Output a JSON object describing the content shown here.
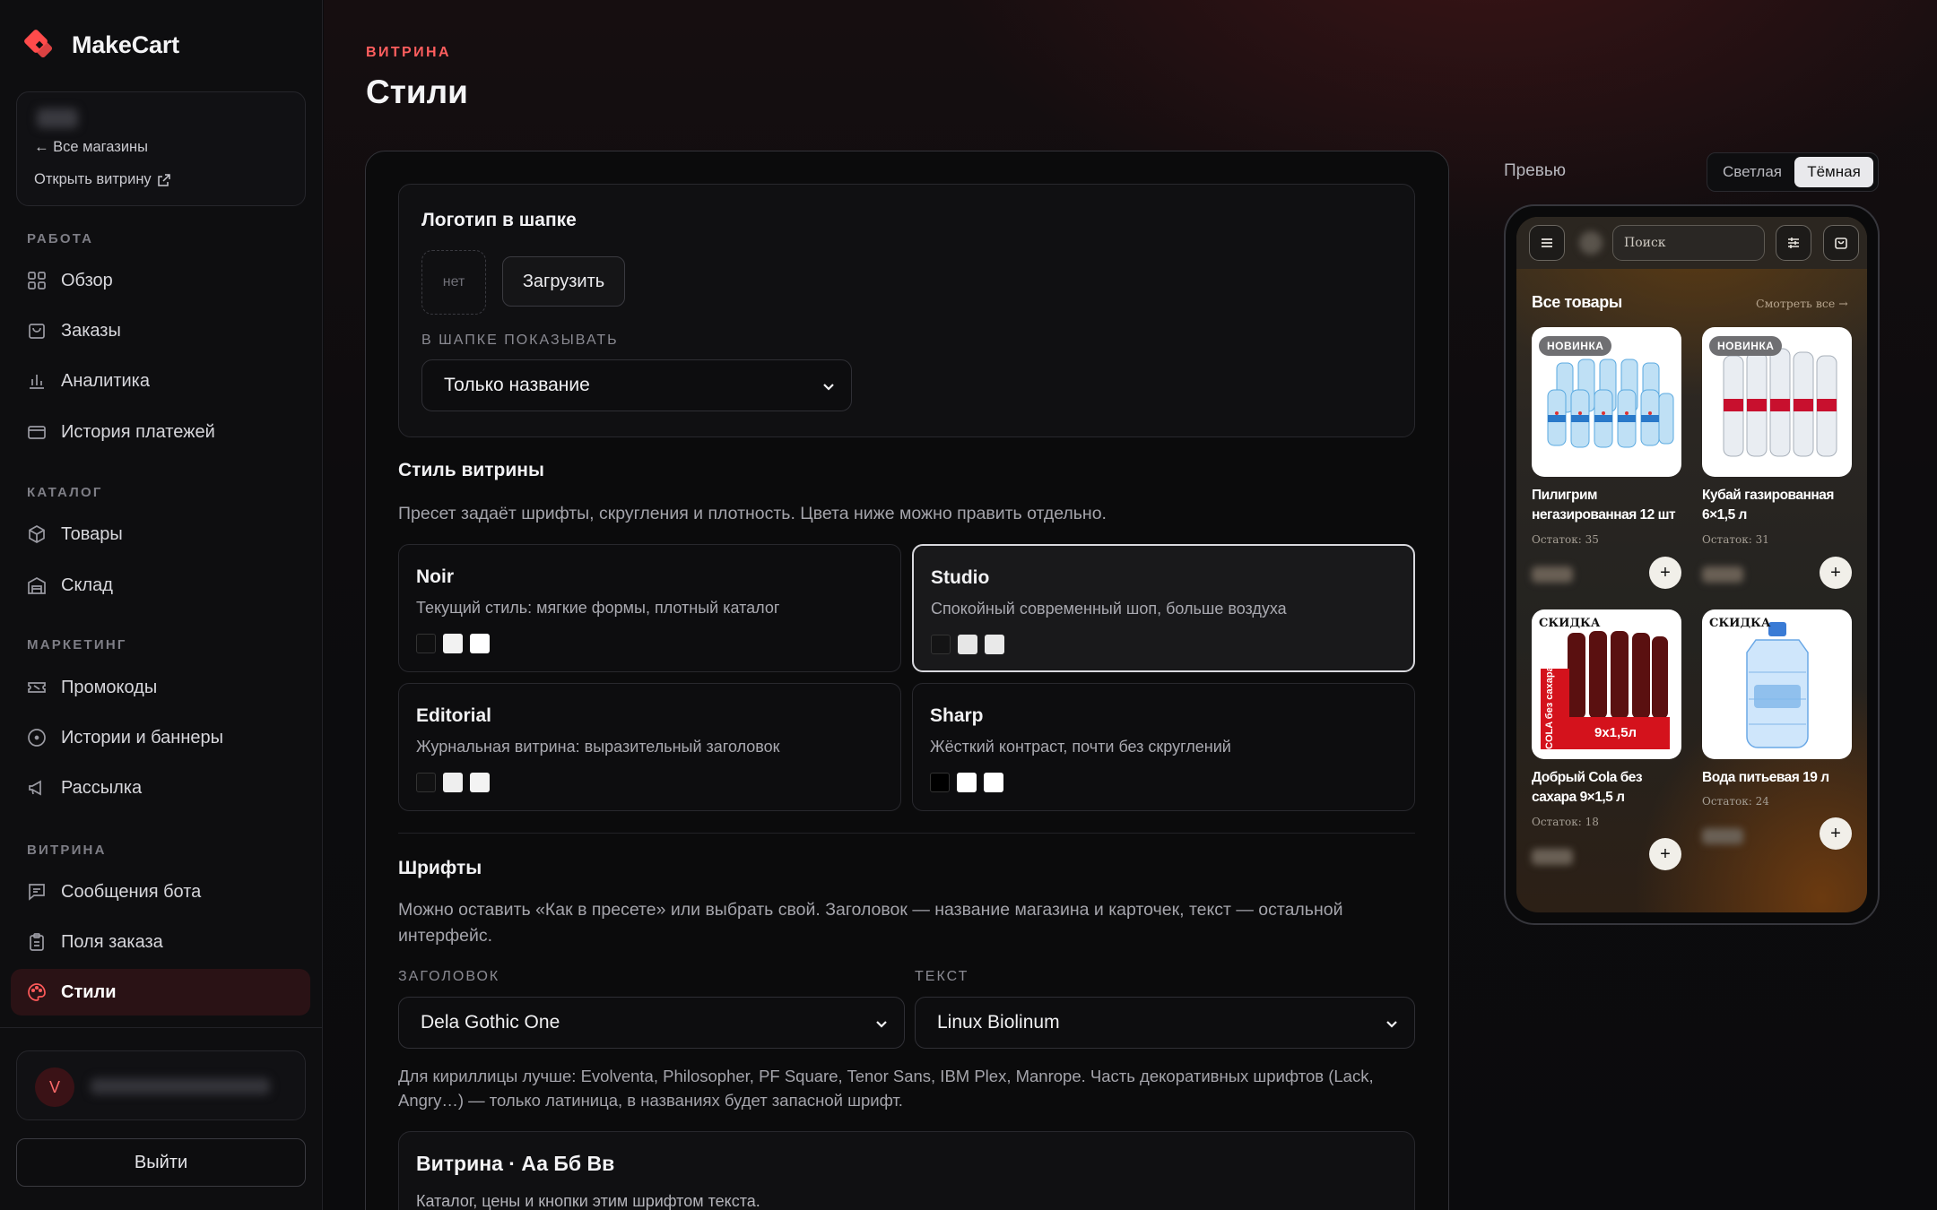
{
  "app": {
    "name": "MakeCart",
    "accent": "#ff4b4b"
  },
  "store_box": {
    "back_label": "← Все магазины",
    "open_label": "Открыть витрину"
  },
  "sidebar": {
    "work_label": "РАБОТА",
    "work_items": [
      {
        "label": "Обзор",
        "icon": "grid-icon"
      },
      {
        "label": "Заказы",
        "icon": "bag-icon"
      },
      {
        "label": "Аналитика",
        "icon": "bar-chart-icon"
      },
      {
        "label": "История платежей",
        "icon": "card-icon"
      }
    ],
    "catalog_label": "КАТАЛОГ",
    "catalog_items": [
      {
        "label": "Товары",
        "icon": "box-icon"
      },
      {
        "label": "Склад",
        "icon": "warehouse-icon"
      }
    ],
    "marketing_label": "МАРКЕТИНГ",
    "marketing_items": [
      {
        "label": "Промокоды",
        "icon": "ticket-icon"
      },
      {
        "label": "Истории и баннеры",
        "icon": "circle-dot-icon"
      },
      {
        "label": "Рассылка",
        "icon": "megaphone-icon"
      }
    ],
    "storefront_label": "ВИТРИНА",
    "storefront_items": [
      {
        "label": "Сообщения бота",
        "icon": "message-icon"
      },
      {
        "label": "Поля заказа",
        "icon": "clipboard-icon"
      },
      {
        "label": "Стили",
        "icon": "palette-icon",
        "active": true
      }
    ],
    "avatar_letter": "V",
    "logout_label": "Выйти"
  },
  "header": {
    "eyebrow": "ВИТРИНА",
    "title": "Стили"
  },
  "logo_section": {
    "title": "Логотип в шапке",
    "placeholder_text": "нет",
    "upload_label": "Загрузить",
    "show_label": "В ШАПКЕ ПОКАЗЫВАТЬ",
    "show_value": "Только название"
  },
  "style_section": {
    "title": "Стиль витрины",
    "description": "Пресет задаёт шрифты, скругления и плотность. Цвета ниже можно править отдельно.",
    "presets": [
      {
        "name": "Noir",
        "desc": "Текущий стиль: мягкие формы, плотный каталог",
        "swatches": [
          "#0f0f10",
          "#f2f2f2",
          "#ffffff"
        ],
        "selected": false
      },
      {
        "name": "Studio",
        "desc": "Спокойный современный шоп, больше воздуха",
        "swatches": [
          "#141415",
          "#e6e6e6",
          "#e9e9e9"
        ],
        "selected": true
      },
      {
        "name": "Editorial",
        "desc": "Журнальная витрина: выразительный заголовок",
        "swatches": [
          "#111112",
          "#eeeeee",
          "#f3f3f3"
        ],
        "selected": false
      },
      {
        "name": "Sharp",
        "desc": "Жёсткий контраст, почти без скруглений",
        "swatches": [
          "#000000",
          "#ffffff",
          "#ffffff"
        ],
        "selected": false
      }
    ]
  },
  "fonts_section": {
    "title": "Шрифты",
    "description": "Можно оставить «Как в пресете» или выбрать свой. Заголовок — название магазина и карточек, текст — остальной интерфейс.",
    "heading_label": "ЗАГОЛОВОК",
    "heading_value": "Dela Gothic One",
    "text_label": "ТЕКСТ",
    "text_value": "Linux Biolinum",
    "note": "Для кириллицы лучше: Evolventa, Philosopher, PF Square, Tenor Sans, IBM Plex, Manrope. Часть декоративных шрифтов (Lack, Angry…) — только латиница, в названиях будет запасной шрифт.",
    "sample_title": "Витрина · Аа Бб Вв",
    "sample_text": "Каталог, цены и кнопки этим шрифтом текста."
  },
  "preview": {
    "label": "Превью",
    "light_label": "Светлая",
    "dark_label": "Тёмная",
    "mode": "dark",
    "search_placeholder": "Поиск",
    "section_title": "Все товары",
    "see_all": "Смотреть все →",
    "products": [
      {
        "badge": "НОВИНКА",
        "name": "Пилигрим негазированная 12 шт",
        "stock": "Остаток: 35"
      },
      {
        "badge": "НОВИНКА",
        "name": "Кубай газированная 6×1,5 л",
        "stock": "Остаток: 31"
      },
      {
        "badge": "СКИДКА",
        "name": "Добрый Cola без сахара 9×1,5 л",
        "stock": "Остаток: 18",
        "pack_text": "9х1,5л",
        "side_text": "COLA без сахара"
      },
      {
        "badge": "СКИДКА",
        "name": "Вода питьевая 19 л",
        "stock": "Остаток: 24"
      }
    ]
  }
}
